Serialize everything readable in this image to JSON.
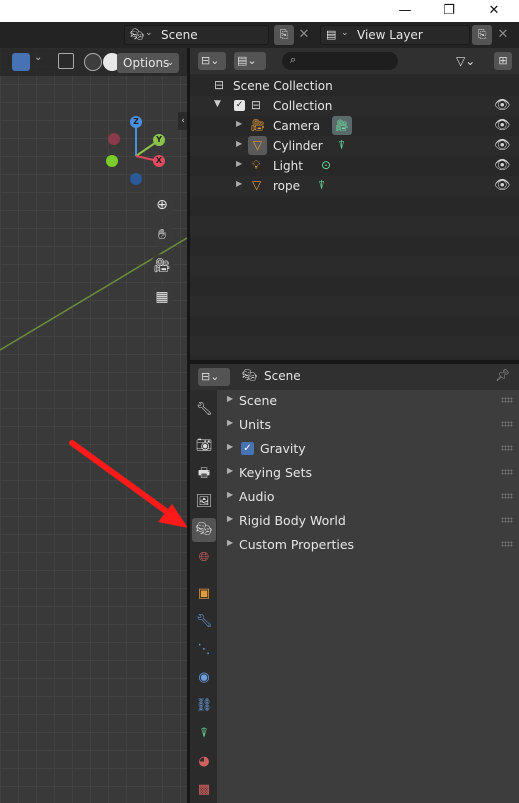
{
  "window": {
    "minimize": "—",
    "maximize": "❐",
    "close": "✕"
  },
  "topbar": {
    "scene_name": "Scene",
    "view_layer_name": "View Layer"
  },
  "viewport": {
    "options_label": "Options",
    "gizmo": {
      "z": "Z",
      "y": "Y",
      "x": "X"
    }
  },
  "outliner": {
    "root": "Scene Collection",
    "collection": "Collection",
    "objects": [
      {
        "name": "Camera",
        "type": "camera"
      },
      {
        "name": "Cylinder",
        "type": "mesh"
      },
      {
        "name": "Light",
        "type": "light"
      },
      {
        "name": "rope",
        "type": "mesh"
      }
    ]
  },
  "properties": {
    "context_label": "Scene",
    "panels": [
      {
        "label": "Scene"
      },
      {
        "label": "Units"
      },
      {
        "label": "Gravity",
        "checkbox": true
      },
      {
        "label": "Keying Sets"
      },
      {
        "label": "Audio"
      },
      {
        "label": "Rigid Body World"
      },
      {
        "label": "Custom Properties"
      }
    ]
  },
  "colors": {
    "accent": "#4772b3",
    "arrow": "#ff1a1a",
    "mesh_green": "#6be0a0",
    "object_orange": "#e59a3a"
  }
}
